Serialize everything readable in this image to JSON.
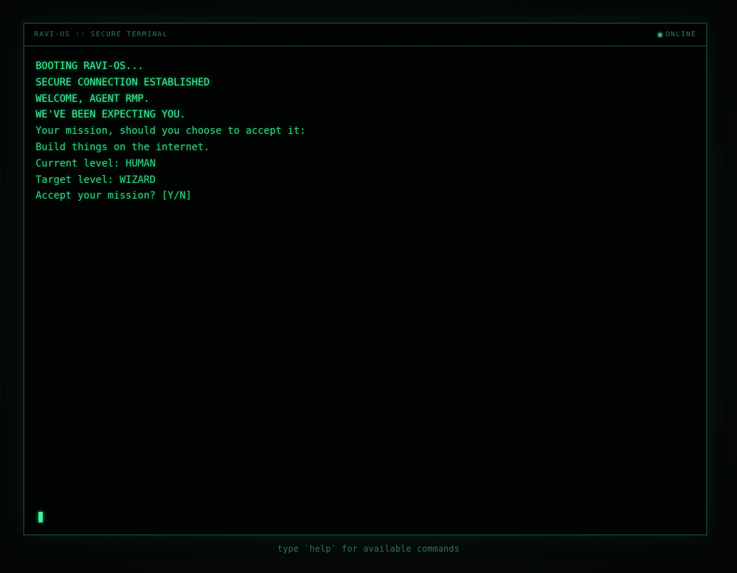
{
  "window": {
    "title": "RAVI-OS :: SECURE TERMINAL",
    "status_label": "ONLINE",
    "status_icon": "status-dot-icon"
  },
  "output": {
    "lines": [
      "BOOTING RAVI-OS...",
      "SECURE CONNECTION ESTABLISHED",
      "WELCOME, AGENT RMP.",
      "WE'VE BEEN EXPECTING YOU.",
      "Your mission, should you choose to accept it:",
      "Build things on the internet.",
      "Current level: HUMAN",
      "Target level: WIZARD",
      "Accept your mission? [Y/N]"
    ]
  },
  "footer": {
    "hint": "type `help` for available commands"
  },
  "colors": {
    "accent": "#3ef59a",
    "text": "#2fd886",
    "dim": "#2e7a55",
    "border": "#1e5a3c",
    "background": "#020403"
  }
}
